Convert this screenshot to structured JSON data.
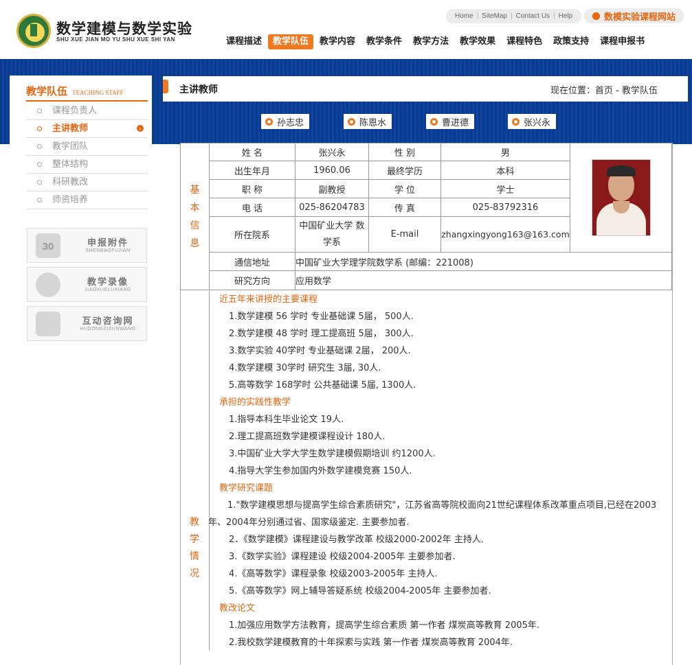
{
  "header": {
    "site_title": "数学建模与数学实验",
    "site_subtitle": "SHU XUE JIAN MO YU SHU XUE SHI YAN",
    "top_links": [
      "Home",
      "SiteMap",
      "Contact Us",
      "Help"
    ],
    "site_button": "数模实验课程网站",
    "nav": [
      "课程描述",
      "教学队伍",
      "教学内容",
      "教学条件",
      "教学方法",
      "教学效果",
      "课程特色",
      "政策支持",
      "课程申报书"
    ],
    "active_nav": "教学队伍"
  },
  "sidebar": {
    "title": "教学队伍",
    "title_en": "TEACHING STAFF",
    "items": [
      "课程负责人",
      "主讲教师",
      "教学团队",
      "整体结构",
      "科研教改",
      "师资培养"
    ],
    "active_item": "主讲教师",
    "promos": [
      {
        "title": "申报附件",
        "sub": "SHENBAOFUJIAN",
        "icon": "calendar-icon",
        "icon_text": "30"
      },
      {
        "title": "教学录像",
        "sub": "JIAOXUELUXIANG",
        "icon": "person-icon"
      },
      {
        "title": "互动咨询网",
        "sub": "HUDONGZIXUNWANG",
        "icon": "computer-icon"
      }
    ]
  },
  "content": {
    "title": "主讲教师",
    "breadcrumb_prefix": "现在位置：",
    "breadcrumb_home": "首页",
    "breadcrumb_sep": " - ",
    "breadcrumb_current": "教学队伍"
  },
  "teacher_tabs": [
    "孙志忠",
    "陈恩水",
    "曹进德",
    "张兴永"
  ],
  "info": {
    "section_label": "基本信息",
    "name_label": "姓 名",
    "name": "张兴永",
    "gender_label": "性 别",
    "gender": "男",
    "birth_label": "出生年月",
    "birth": "1960.06",
    "edu_label": "最终学历",
    "edu": "本科",
    "title_label": "职 称",
    "title": "副教授",
    "degree_label": "学 位",
    "degree": "学士",
    "phone_label": "电 话",
    "phone": "025-86204783",
    "fax_label": "传 真",
    "fax": "025-83792316",
    "dept_label": "所在院系",
    "dept": "中国矿业大学 数学系",
    "email_label": "E-mail",
    "email": "zhangxingyong163@163.com",
    "address_label": "通信地址",
    "address": "中国矿业大学理学院数学系 (邮编：221008)",
    "research_label": "研究方向",
    "research": "应用数学"
  },
  "teaching": {
    "section_label": "教学情况",
    "sections": [
      {
        "title": "近五年来讲授的主要课程",
        "lines": [
          "1.数学建模 56 学时 专业基础课 5届， 500人.",
          "2.数学建模 48 学时 理工提高班 5届， 300人.",
          "3.数学实验 40学时 专业基础课 2届， 200人.",
          "4.数学建模 30学时 研究生 3届, 30人.",
          "5.高等数学 168学时 公共基础课 5届, 1300人."
        ]
      },
      {
        "title": "承担的实践性教学",
        "lines": [
          "1.指导本科生毕业论文 19人.",
          "2.理工提高班数学建模课程设计 180人.",
          "3.中国矿业大学大学生数学建模假期培训 约1200人.",
          "4.指导大学生参加国内外数学建模竞赛 150人."
        ]
      },
      {
        "title": "教学研究课题",
        "lines": [
          "1.\"数学建模思想与提高学生综合素质研究\"，江苏省高等院校面向21世纪课程体系改革重点项目,已经在2003年、2004年分别通过省、国家级鉴定. 主要参加者.",
          "2．《数学建模》课程建设与教学改革 校级2000-2002年 主持人.",
          "3.《数学实验》课程建设 校级2004-2005年 主要参加者.",
          "4.《高等数学》课程录象 校级2003-2005年 主持人.",
          "5.《高等数学》网上辅导答疑系统 校级2004-2005年 主要参加者."
        ]
      },
      {
        "title": "教改论文",
        "lines": [
          "1.加强应用数学方法教育，提高学生综合素质 第一作者 煤炭高等教育 2005年.",
          "2.我校数学建模教育的十年探索与实践 第一作者 煤炭高等教育 2004年."
        ]
      }
    ]
  },
  "colors": {
    "accent": "#f0781e",
    "band": "#0b3a8c",
    "label": "#e8650e"
  }
}
